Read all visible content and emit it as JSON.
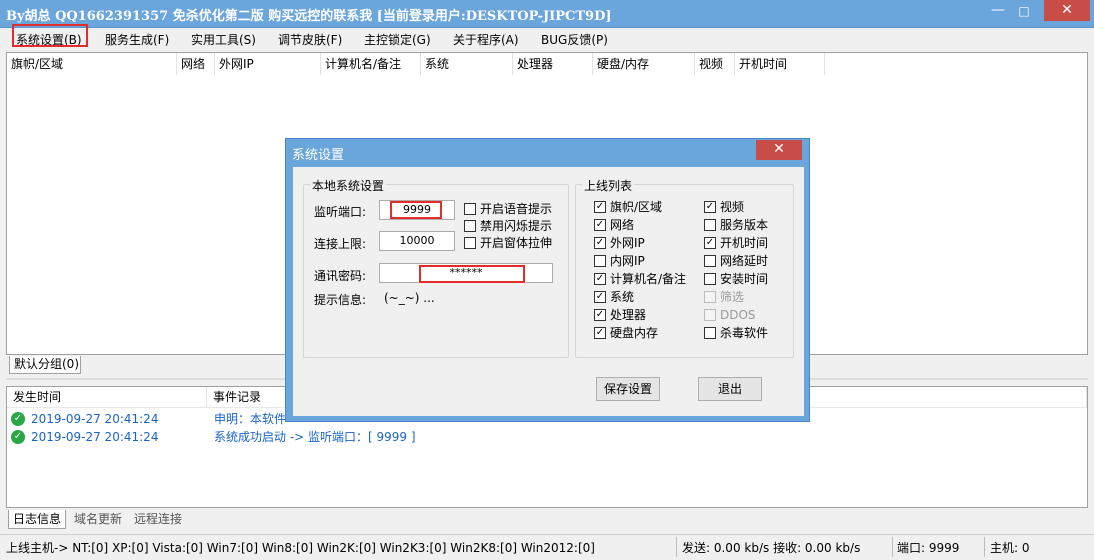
{
  "window": {
    "title": "By胡总  QQ1662391357 免杀优化第二版 购买远控的联系我 [当前登录用户:DESKTOP-JIPCT9D]",
    "minimize": "—",
    "maximize": "□",
    "close": "✕"
  },
  "menu": [
    "系统设置(B)",
    "服务生成(F)",
    "实用工具(S)",
    "调节皮肤(F)",
    "主控锁定(G)",
    "关于程序(A)",
    "BUG反馈(P)"
  ],
  "host_columns": [
    "旗帜/区域",
    "网络",
    "外网IP",
    "计算机名/备注",
    "系统",
    "处理器",
    "硬盘/内存",
    "视频",
    "开机时间"
  ],
  "group_tab": "默认分组(0)",
  "log": {
    "columns": [
      "发生时间",
      "事件记录"
    ],
    "rows": [
      {
        "time": "2019-09-27 20:41:24",
        "text": "申明：本软件"
      },
      {
        "time": "2019-09-27 20:41:24",
        "text": "系统成功启动 -> 监听端口：[ 9999 ]"
      }
    ]
  },
  "bottom_tabs": [
    "日志信息",
    "域名更新",
    "远程连接"
  ],
  "status": {
    "hosts_online": "上线主机-> NT:[0] XP:[0] Vista:[0] Win7:[0] Win8:[0] Win2K:[0] Win2K3:[0] Win2K8:[0] Win2012:[0]",
    "traffic": "发送: 0.00 kb/s 接收: 0.00 kb/s",
    "port": "端口: 9999",
    "host_count": "主机: 0"
  },
  "dialog": {
    "title": "系统设置",
    "close": "✕",
    "local_group": {
      "title": "本地系统设置",
      "port_label": "监听端口:",
      "port_value": "9999",
      "limit_label": "连接上限:",
      "limit_value": "10000",
      "password_label": "通讯密码:",
      "password_value": "******",
      "hint_label": "提示信息:",
      "hint_value": "(~_~) ...",
      "options": [
        {
          "label": "开启语音提示",
          "checked": false
        },
        {
          "label": "禁用闪烁提示",
          "checked": false
        },
        {
          "label": "开启窗体拉伸",
          "checked": false
        }
      ]
    },
    "online_group": {
      "title": "上线列表",
      "left": [
        {
          "label": "旗帜/区域",
          "checked": true,
          "disabled": false
        },
        {
          "label": "网络",
          "checked": true,
          "disabled": false
        },
        {
          "label": "外网IP",
          "checked": true,
          "disabled": false
        },
        {
          "label": "内网IP",
          "checked": false,
          "disabled": false
        },
        {
          "label": "计算机名/备注",
          "checked": true,
          "disabled": false
        },
        {
          "label": "系统",
          "checked": true,
          "disabled": false
        },
        {
          "label": "处理器",
          "checked": true,
          "disabled": false
        },
        {
          "label": "硬盘内存",
          "checked": true,
          "disabled": false
        }
      ],
      "right": [
        {
          "label": "视频",
          "checked": true,
          "disabled": false
        },
        {
          "label": "服务版本",
          "checked": false,
          "disabled": false
        },
        {
          "label": "开机时间",
          "checked": true,
          "disabled": false
        },
        {
          "label": "网络延时",
          "checked": false,
          "disabled": false
        },
        {
          "label": "安装时间",
          "checked": false,
          "disabled": false
        },
        {
          "label": "筛选",
          "checked": false,
          "disabled": true
        },
        {
          "label": "DDOS",
          "checked": false,
          "disabled": true
        },
        {
          "label": "杀毒软件",
          "checked": false,
          "disabled": false
        }
      ]
    },
    "save_label": "保存设置",
    "exit_label": "退出"
  }
}
